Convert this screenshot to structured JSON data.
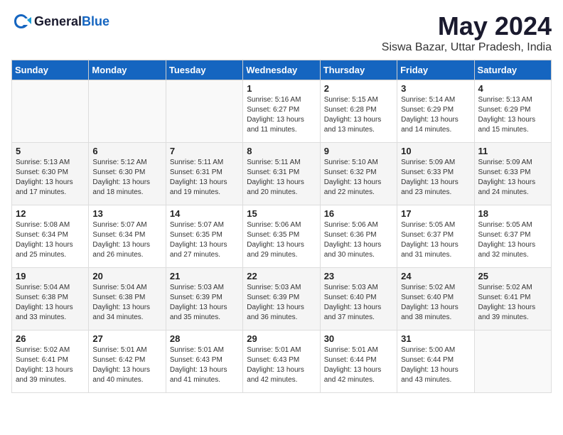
{
  "header": {
    "logo_general": "General",
    "logo_blue": "Blue",
    "title": "May 2024",
    "subtitle": "Siswa Bazar, Uttar Pradesh, India"
  },
  "weekdays": [
    "Sunday",
    "Monday",
    "Tuesday",
    "Wednesday",
    "Thursday",
    "Friday",
    "Saturday"
  ],
  "weeks": [
    [
      {
        "day": "",
        "content": ""
      },
      {
        "day": "",
        "content": ""
      },
      {
        "day": "",
        "content": ""
      },
      {
        "day": "1",
        "content": "Sunrise: 5:16 AM\nSunset: 6:27 PM\nDaylight: 13 hours\nand 11 minutes."
      },
      {
        "day": "2",
        "content": "Sunrise: 5:15 AM\nSunset: 6:28 PM\nDaylight: 13 hours\nand 13 minutes."
      },
      {
        "day": "3",
        "content": "Sunrise: 5:14 AM\nSunset: 6:29 PM\nDaylight: 13 hours\nand 14 minutes."
      },
      {
        "day": "4",
        "content": "Sunrise: 5:13 AM\nSunset: 6:29 PM\nDaylight: 13 hours\nand 15 minutes."
      }
    ],
    [
      {
        "day": "5",
        "content": "Sunrise: 5:13 AM\nSunset: 6:30 PM\nDaylight: 13 hours\nand 17 minutes."
      },
      {
        "day": "6",
        "content": "Sunrise: 5:12 AM\nSunset: 6:30 PM\nDaylight: 13 hours\nand 18 minutes."
      },
      {
        "day": "7",
        "content": "Sunrise: 5:11 AM\nSunset: 6:31 PM\nDaylight: 13 hours\nand 19 minutes."
      },
      {
        "day": "8",
        "content": "Sunrise: 5:11 AM\nSunset: 6:31 PM\nDaylight: 13 hours\nand 20 minutes."
      },
      {
        "day": "9",
        "content": "Sunrise: 5:10 AM\nSunset: 6:32 PM\nDaylight: 13 hours\nand 22 minutes."
      },
      {
        "day": "10",
        "content": "Sunrise: 5:09 AM\nSunset: 6:33 PM\nDaylight: 13 hours\nand 23 minutes."
      },
      {
        "day": "11",
        "content": "Sunrise: 5:09 AM\nSunset: 6:33 PM\nDaylight: 13 hours\nand 24 minutes."
      }
    ],
    [
      {
        "day": "12",
        "content": "Sunrise: 5:08 AM\nSunset: 6:34 PM\nDaylight: 13 hours\nand 25 minutes."
      },
      {
        "day": "13",
        "content": "Sunrise: 5:07 AM\nSunset: 6:34 PM\nDaylight: 13 hours\nand 26 minutes."
      },
      {
        "day": "14",
        "content": "Sunrise: 5:07 AM\nSunset: 6:35 PM\nDaylight: 13 hours\nand 27 minutes."
      },
      {
        "day": "15",
        "content": "Sunrise: 5:06 AM\nSunset: 6:35 PM\nDaylight: 13 hours\nand 29 minutes."
      },
      {
        "day": "16",
        "content": "Sunrise: 5:06 AM\nSunset: 6:36 PM\nDaylight: 13 hours\nand 30 minutes."
      },
      {
        "day": "17",
        "content": "Sunrise: 5:05 AM\nSunset: 6:37 PM\nDaylight: 13 hours\nand 31 minutes."
      },
      {
        "day": "18",
        "content": "Sunrise: 5:05 AM\nSunset: 6:37 PM\nDaylight: 13 hours\nand 32 minutes."
      }
    ],
    [
      {
        "day": "19",
        "content": "Sunrise: 5:04 AM\nSunset: 6:38 PM\nDaylight: 13 hours\nand 33 minutes."
      },
      {
        "day": "20",
        "content": "Sunrise: 5:04 AM\nSunset: 6:38 PM\nDaylight: 13 hours\nand 34 minutes."
      },
      {
        "day": "21",
        "content": "Sunrise: 5:03 AM\nSunset: 6:39 PM\nDaylight: 13 hours\nand 35 minutes."
      },
      {
        "day": "22",
        "content": "Sunrise: 5:03 AM\nSunset: 6:39 PM\nDaylight: 13 hours\nand 36 minutes."
      },
      {
        "day": "23",
        "content": "Sunrise: 5:03 AM\nSunset: 6:40 PM\nDaylight: 13 hours\nand 37 minutes."
      },
      {
        "day": "24",
        "content": "Sunrise: 5:02 AM\nSunset: 6:40 PM\nDaylight: 13 hours\nand 38 minutes."
      },
      {
        "day": "25",
        "content": "Sunrise: 5:02 AM\nSunset: 6:41 PM\nDaylight: 13 hours\nand 39 minutes."
      }
    ],
    [
      {
        "day": "26",
        "content": "Sunrise: 5:02 AM\nSunset: 6:41 PM\nDaylight: 13 hours\nand 39 minutes."
      },
      {
        "day": "27",
        "content": "Sunrise: 5:01 AM\nSunset: 6:42 PM\nDaylight: 13 hours\nand 40 minutes."
      },
      {
        "day": "28",
        "content": "Sunrise: 5:01 AM\nSunset: 6:43 PM\nDaylight: 13 hours\nand 41 minutes."
      },
      {
        "day": "29",
        "content": "Sunrise: 5:01 AM\nSunset: 6:43 PM\nDaylight: 13 hours\nand 42 minutes."
      },
      {
        "day": "30",
        "content": "Sunrise: 5:01 AM\nSunset: 6:44 PM\nDaylight: 13 hours\nand 42 minutes."
      },
      {
        "day": "31",
        "content": "Sunrise: 5:00 AM\nSunset: 6:44 PM\nDaylight: 13 hours\nand 43 minutes."
      },
      {
        "day": "",
        "content": ""
      }
    ]
  ]
}
